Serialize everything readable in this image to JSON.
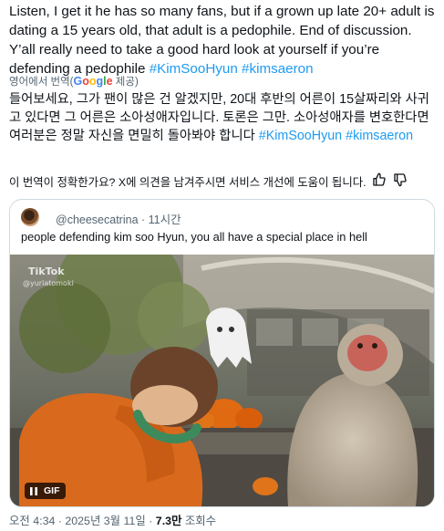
{
  "tweet": {
    "text_prefix": "Listen, I get it he has so many fans, but if a grown up late 20+ adult is dating a 15 years old, that adult is a pedophile. End of discussion.  Y’all really need to take a good hard look at yourself if you’re defending a pedophile ",
    "hashtag_1": "#KimSooHyun",
    "hashtag_2": "#kimsaeron"
  },
  "translation_credit": {
    "prefix": "영어에서 번역(",
    "google_letters": [
      "G",
      "o",
      "o",
      "g",
      "l",
      "e"
    ],
    "suffix": " 제공)"
  },
  "translation": {
    "text_prefix": "들어보세요, 그가 팬이 많은 건 알겠지만, 20대 후반의 어른이 15살짜리와 사귀고 있다면 그 어른은 소아성애자입니다. 토론은 그만. 소아성애자를 변호한다면 여러분은 정말 자신을 면밀히 돌아봐야 합니다 ",
    "hashtag_1": "#KimSooHyun",
    "hashtag_2": "#kimsaeron"
  },
  "feedback": {
    "question": "이 번역이 정확한가요? X에 의견을 남겨주시면 서비스 개선에 도움이 됩니다.",
    "thumbs_up_icon": "thumbs-up-icon",
    "thumbs_down_icon": "thumbs-down-icon"
  },
  "quoted_tweet": {
    "handle": "@cheesecatrina",
    "separator": " · ",
    "time_ago": "11시간",
    "text": "people defending kim soo Hyun, you all have a special place in hell",
    "media": {
      "watermark_brand": "TikTok",
      "watermark_user": "@yuriatomoki",
      "badge_label": "GIF",
      "pause_icon": "pause-icon"
    }
  },
  "meta": {
    "time": "오전 4:34",
    "sep1": " · ",
    "date": "2025년 3월 11일",
    "sep2": " · ",
    "views_count": "7.3만",
    "views_label": " 조회수"
  },
  "colors": {
    "link": "#1d9bf0",
    "secondary_text": "#536471",
    "border": "#cfd9de"
  }
}
